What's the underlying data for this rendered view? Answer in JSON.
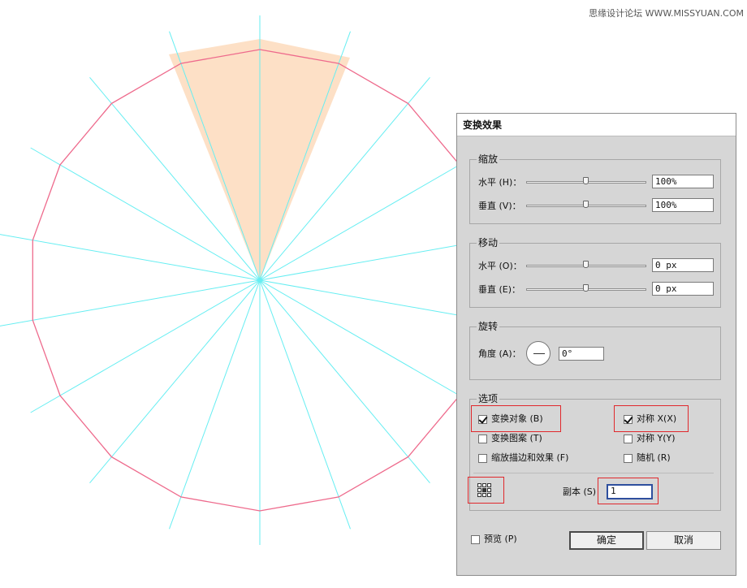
{
  "watermark": "思缘设计论坛 WWW.MISSYUAN.COM",
  "dialog": {
    "title": "变换效果",
    "scale": {
      "legend": "缩放",
      "horizontal_label": "水平 (H)：",
      "horizontal_value": "100%",
      "vertical_label": "垂直 (V)：",
      "vertical_value": "100%"
    },
    "move": {
      "legend": "移动",
      "horizontal_label": "水平 (O)：",
      "horizontal_value": "0 px",
      "vertical_label": "垂直 (E)：",
      "vertical_value": "0 px"
    },
    "rotate": {
      "legend": "旋转",
      "angle_label": "角度 (A)：",
      "angle_value": "0°"
    },
    "options": {
      "legend": "选项",
      "transform_objects": "变换对象 (B)",
      "transform_patterns": "变换图案 (T)",
      "scale_strokes": "缩放描边和效果 (F)",
      "reflect_x": "对称 X(X)",
      "reflect_y": "对称 Y(Y)",
      "random": "随机 (R)",
      "copies_label": "副本 (S)",
      "copies_value": "1",
      "transform_objects_checked": true,
      "transform_patterns_checked": false,
      "scale_strokes_checked": false,
      "reflect_x_checked": true,
      "reflect_y_checked": false,
      "random_checked": false
    },
    "preview_label": "预览 (P)",
    "preview_checked": false,
    "ok_label": "确定",
    "cancel_label": "取消"
  },
  "colors": {
    "guide_lines": "#66eef2",
    "polygon_stroke": "#ee6a8c",
    "wedge_fill": "#fde0c6",
    "dialog_bg": "#d6d6d6",
    "highlight_box": "#e0282c"
  }
}
